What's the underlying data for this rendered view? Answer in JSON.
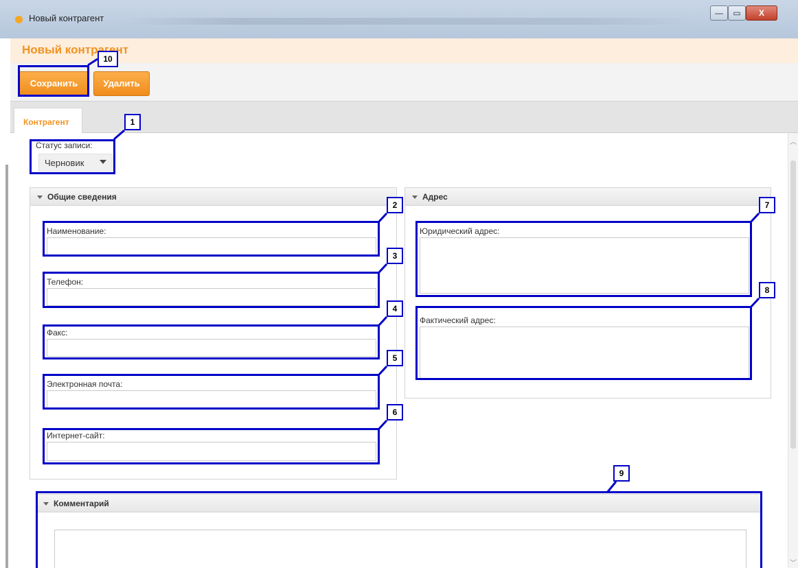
{
  "window": {
    "title": "Новый контрагент",
    "min_glyph": "—",
    "max_glyph": "▭",
    "close_glyph": "X"
  },
  "header": {
    "title": "Новый контрагент"
  },
  "toolbar": {
    "save_label": "Сохранить",
    "delete_label": "Удалить"
  },
  "tabs": [
    {
      "label": "Контрагент",
      "active": true
    }
  ],
  "status": {
    "label": "Статус записи:",
    "value": "Черновик"
  },
  "general": {
    "title": "Общие сведения",
    "fields": [
      {
        "label": "Наименование:",
        "value": ""
      },
      {
        "label": "Телефон:",
        "value": ""
      },
      {
        "label": "Факс:",
        "value": ""
      },
      {
        "label": "Электронная почта:",
        "value": ""
      },
      {
        "label": "Интернет-сайт:",
        "value": ""
      }
    ]
  },
  "address": {
    "title": "Адрес",
    "fields": [
      {
        "label": "Юридический адрес:",
        "value": ""
      },
      {
        "label": "Фактический адрес:",
        "value": ""
      }
    ]
  },
  "comment": {
    "title": "Комментарий",
    "value": ""
  },
  "annotations": [
    "1",
    "2",
    "3",
    "4",
    "5",
    "6",
    "7",
    "8",
    "9",
    "10"
  ],
  "colors": {
    "accent": "#f29322",
    "annotation": "#0000c8"
  }
}
